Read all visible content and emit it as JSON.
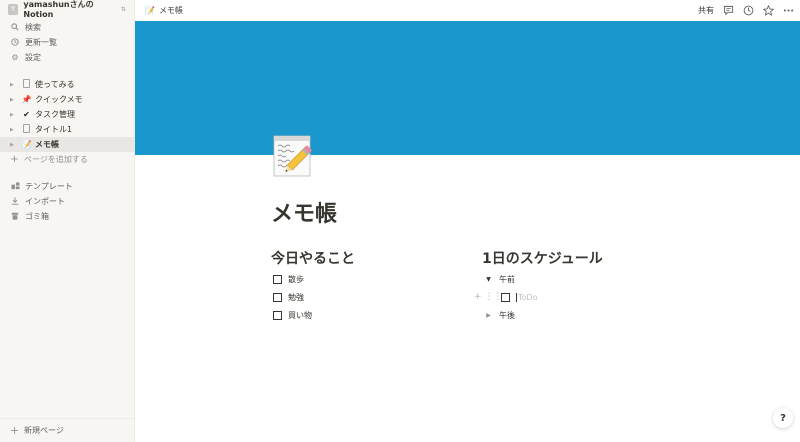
{
  "workspace": {
    "avatar_letter": "Y",
    "name": "yamashunさんのNotion",
    "chevron": "⌃⌄"
  },
  "sidebar": {
    "nav": [
      {
        "label": "検索",
        "icon": "search-icon"
      },
      {
        "label": "更新一覧",
        "icon": "clock-icon"
      },
      {
        "label": "設定",
        "icon": "gear-icon"
      }
    ],
    "pages": [
      {
        "label": "使ってみる",
        "icon": "document-icon"
      },
      {
        "label": "クイックメモ",
        "icon": "pushpin-emoji"
      },
      {
        "label": "タスク管理",
        "icon": "checkmark-emoji"
      },
      {
        "label": "タイトル1",
        "icon": "document-icon"
      },
      {
        "label": "メモ帳",
        "icon": "memo-emoji",
        "active": true
      }
    ],
    "add_page": "ページを追加する",
    "tools": [
      {
        "label": "テンプレート",
        "icon": "template-icon"
      },
      {
        "label": "インポート",
        "icon": "import-icon"
      },
      {
        "label": "ゴミ箱",
        "icon": "trash-icon"
      }
    ],
    "new_page": "新規ページ"
  },
  "topbar": {
    "breadcrumb": "メモ帳",
    "share": "共有"
  },
  "page": {
    "title": "メモ帳",
    "cover_color": "#1a97cc",
    "left": {
      "heading": "今日やること",
      "todos": [
        {
          "label": "散歩",
          "checked": false
        },
        {
          "label": "勉強",
          "checked": false
        },
        {
          "label": "買い物",
          "checked": false
        }
      ]
    },
    "right": {
      "heading": "1日のスケジュール",
      "toggles": [
        {
          "label": "午前",
          "open": true
        },
        {
          "label": "午後",
          "open": false
        }
      ],
      "todo_placeholder": "ToDo"
    }
  },
  "help": "?"
}
